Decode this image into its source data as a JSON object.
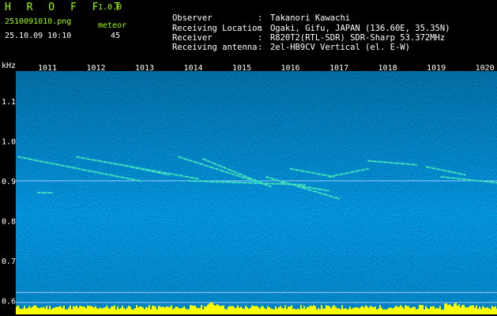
{
  "app": {
    "logo": "H R O F F T",
    "version": "1.0.0"
  },
  "capture": {
    "filename": "2510091010.png",
    "datetime": "25.10.09 10:10",
    "meteor_label": "meteor",
    "meteor_count": "45"
  },
  "info": [
    {
      "key": "Observer",
      "sep": ":",
      "value": "Takanori Kawachi"
    },
    {
      "key": "Receiving Location",
      "sep": ":",
      "value": "Ogaki, Gifu, JAPAN (136.60E, 35.35N)"
    },
    {
      "key": "Receiver",
      "sep": ":",
      "value": "R820T2(RTL-SDR) SDR-Sharp 53.372MHz"
    },
    {
      "key": "Receiving antenna",
      "sep": ":",
      "value": "2el-HB9CV Vertical (el. E-W)"
    }
  ],
  "colors": {
    "accent": "#9dff00",
    "text": "#ffffff",
    "background": "#000000",
    "spectrum_base": "#0a0a6e",
    "signal": "#ffff00"
  },
  "chart_data": {
    "type": "heatmap",
    "y_unit_label": "kHz",
    "x_tick_labels": [
      "1011",
      "1012",
      "1013",
      "1014",
      "1015",
      "1016",
      "1017",
      "1018",
      "1019",
      "1020"
    ],
    "x_ticks": [
      1011,
      1012,
      1013,
      1014,
      1015,
      1016,
      1017,
      1018,
      1019,
      1020
    ],
    "xlim": [
      1010.35,
      1020.25
    ],
    "y_tick_labels": [
      "1.1",
      "1.0",
      "0.9",
      "0.8",
      "0.7",
      "0.6"
    ],
    "y_ticks": [
      1.1,
      1.0,
      0.9,
      0.8,
      0.7,
      0.6
    ],
    "ylim": [
      0.575,
      1.175
    ],
    "carrier_khz": 0.9,
    "reference_lines_khz": [
      0.62,
      0.595
    ],
    "meteor_traces": [
      {
        "x": [
          1010.4,
          1012.9
        ],
        "y": [
          0.96,
          0.9
        ]
      },
      {
        "x": [
          1011.6,
          1014.1
        ],
        "y": [
          0.96,
          0.905
        ]
      },
      {
        "x": [
          1012.6,
          1013.5
        ],
        "y": [
          0.938,
          0.915
        ]
      },
      {
        "x": [
          1013.7,
          1015.5
        ],
        "y": [
          0.96,
          0.89
        ]
      },
      {
        "x": [
          1014.2,
          1015.6
        ],
        "y": [
          0.955,
          0.885
        ]
      },
      {
        "x": [
          1015.5,
          1017.0
        ],
        "y": [
          0.91,
          0.855
        ]
      },
      {
        "x": [
          1015.8,
          1016.8
        ],
        "y": [
          0.895,
          0.875
        ]
      },
      {
        "x": [
          1016.0,
          1016.9
        ],
        "y": [
          0.93,
          0.91
        ]
      },
      {
        "x": [
          1013.9,
          1016.3
        ],
        "y": [
          0.9,
          0.89
        ]
      },
      {
        "x": [
          1016.8,
          1017.6
        ],
        "y": [
          0.91,
          0.93
        ]
      },
      {
        "x": [
          1017.6,
          1018.6
        ],
        "y": [
          0.95,
          0.94
        ]
      },
      {
        "x": [
          1018.8,
          1019.6
        ],
        "y": [
          0.935,
          0.915
        ]
      },
      {
        "x": [
          1019.1,
          1020.25
        ],
        "y": [
          0.91,
          0.895
        ]
      },
      {
        "x": [
          1010.8,
          1011.1
        ],
        "y": [
          0.87,
          0.87
        ]
      }
    ]
  }
}
